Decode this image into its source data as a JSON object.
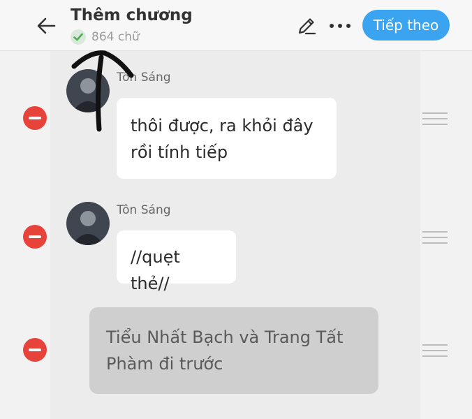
{
  "header": {
    "back_icon": "arrow-left-icon",
    "title": "Thêm chương",
    "word_count": "864 chữ",
    "status_icon": "check-circle-icon",
    "edit_icon": "pencil-icon",
    "more_icon": "more-horizontal-icon",
    "next_label": "Tiếp theo",
    "accent_color": "#3aa4f0"
  },
  "messages": [
    {
      "type": "dialogue",
      "author": "Tôn Sáng",
      "lines": [
        "thôi được, ra khỏi đây",
        "rồi tính tiếp"
      ]
    },
    {
      "type": "dialogue",
      "author": "Tôn Sáng",
      "lines": [
        "//quẹt thẻ//"
      ]
    },
    {
      "type": "narration",
      "lines": [
        "Tiểu Nhất Bạch và Trang Tất",
        "Phàm đi trước"
      ]
    }
  ],
  "colors": {
    "remove_button": "#e8433a",
    "narration_bubble": "#cfcfcf",
    "check": "#4caf50"
  }
}
